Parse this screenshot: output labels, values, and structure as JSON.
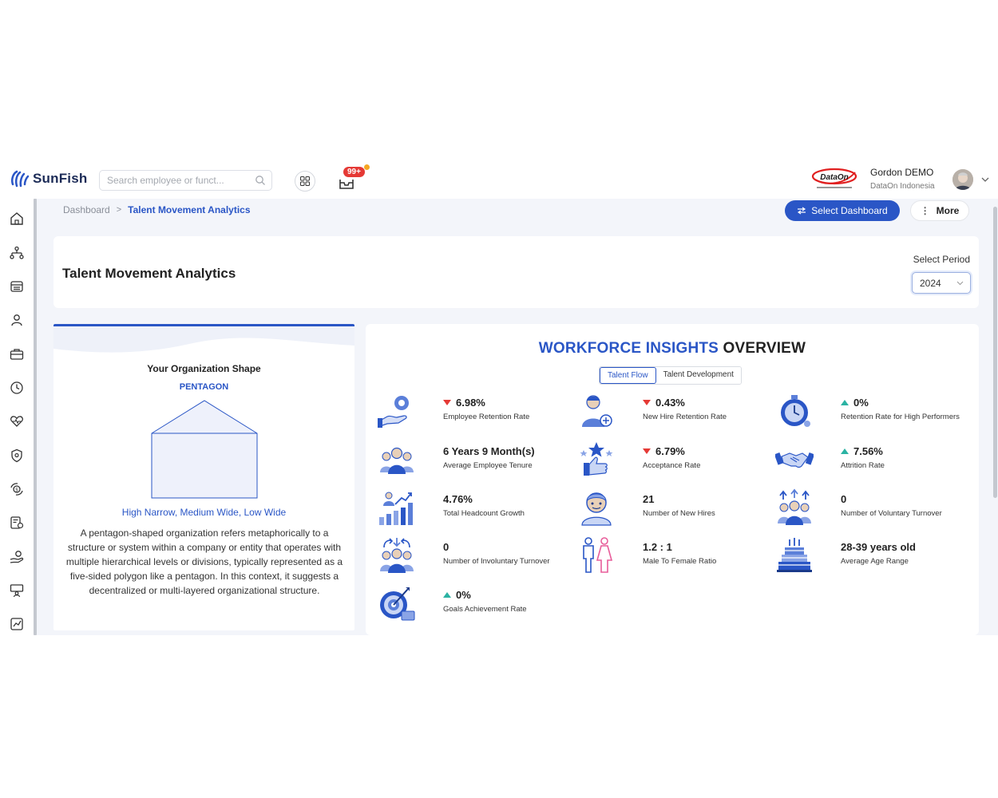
{
  "app": {
    "brand": "SunFish"
  },
  "search": {
    "placeholder": "Search employee or funct..."
  },
  "notifications": {
    "badge": "99+"
  },
  "user": {
    "name": "Gordon DEMO",
    "company": "DataOn Indonesia"
  },
  "colors": {
    "primary": "#2a56c6",
    "down": "#e53935",
    "up": "#2bb3a3"
  },
  "sidebar": {
    "items": [
      {
        "icon": "home-icon"
      },
      {
        "icon": "org-structure-icon"
      },
      {
        "icon": "store-icon"
      },
      {
        "icon": "person-icon"
      },
      {
        "icon": "briefcase-icon"
      },
      {
        "icon": "clock-icon"
      },
      {
        "icon": "heart-icon"
      },
      {
        "icon": "shield-icon"
      },
      {
        "icon": "money-cycle-icon"
      },
      {
        "icon": "document-money-icon"
      },
      {
        "icon": "hand-money-icon"
      },
      {
        "icon": "training-icon"
      },
      {
        "icon": "report-icon"
      }
    ]
  },
  "breadcrumb": {
    "home": "Dashboard",
    "separator": ">",
    "current": "Talent Movement Analytics"
  },
  "toolbar": {
    "select_dashboard": "Select Dashboard",
    "more": "More",
    "more_dots": "⋮"
  },
  "page": {
    "title": "Talent Movement Analytics",
    "period_label": "Select Period",
    "period_value": "2024"
  },
  "org_shape": {
    "title": "Your Organization Shape",
    "name": "PENTAGON",
    "description": "High Narrow, Medium Wide, Low Wide",
    "text": "A pentagon-shaped organization refers metaphorically to a structure or system within a company or entity that operates with multiple hierarchical levels or divisions, typically represented as a five-sided polygon like a pentagon. In this context, it suggests a decentralized or multi-layered organizational structure."
  },
  "overview": {
    "title_blue": "WORKFORCE INSIGHTS",
    "title_dark": "OVERVIEW",
    "tabs": [
      "Talent Flow",
      "Talent Development"
    ],
    "active_tab": "Talent Flow",
    "metrics": [
      {
        "icon": "gear-hand-icon",
        "value": "6.98%",
        "trend": "down",
        "label": "Employee Retention Rate"
      },
      {
        "icon": "new-hire-icon",
        "value": "0.43%",
        "trend": "down",
        "label": "New Hire Retention Rate"
      },
      {
        "icon": "stopwatch-icon",
        "value": "0%",
        "trend": "up",
        "label": "Retention Rate for High Performers"
      },
      {
        "icon": "team-icon",
        "value": "6 Years 9 Month(s)",
        "trend": "none",
        "label": "Average Employee Tenure"
      },
      {
        "icon": "thumbs-up-star-icon",
        "value": "6.79%",
        "trend": "down",
        "label": "Acceptance Rate"
      },
      {
        "icon": "handshake-icon",
        "value": "7.56%",
        "trend": "up",
        "label": "Attrition Rate"
      },
      {
        "icon": "growth-chart-icon",
        "value": "4.76%",
        "trend": "none",
        "label": "Total Headcount Growth"
      },
      {
        "icon": "headcount-icon",
        "value": "21",
        "trend": "none",
        "label": "Number of New Hires"
      },
      {
        "icon": "voluntary-turnover-icon",
        "value": "0",
        "trend": "none",
        "label": "Number of Voluntary Turnover"
      },
      {
        "icon": "involuntary-turnover-icon",
        "value": "0",
        "trend": "none",
        "label": "Number of Involuntary Turnover"
      },
      {
        "icon": "gender-icon",
        "value": "1.2 : 1",
        "trend": "none",
        "label": "Male To Female Ratio"
      },
      {
        "icon": "cake-icon",
        "value": "28-39 years old",
        "trend": "none",
        "label": "Average Age Range"
      },
      {
        "icon": "target-icon",
        "value": "0%",
        "trend": "up",
        "label": "Goals Achievement Rate"
      }
    ]
  }
}
